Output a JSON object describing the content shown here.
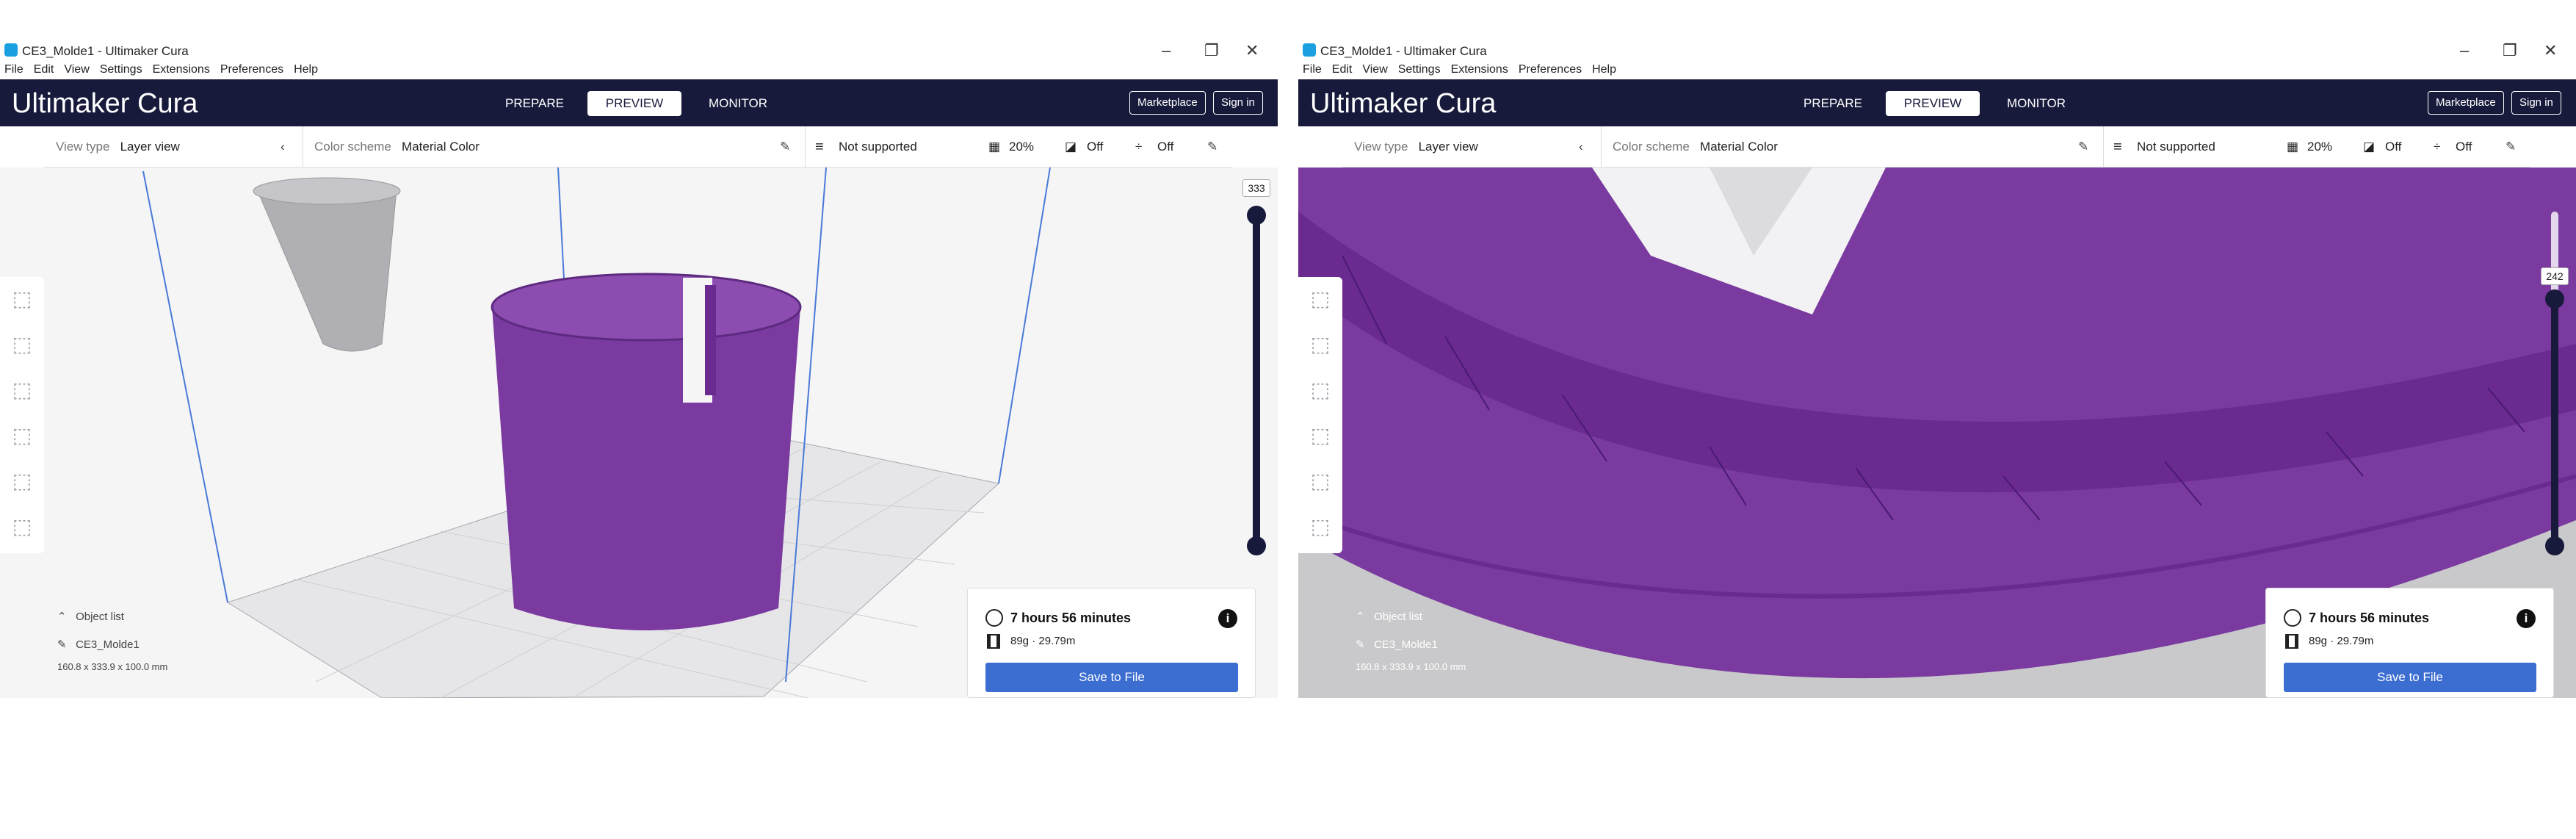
{
  "window": {
    "title": "CE3_Molde1 - Ultimaker Cura",
    "minimize": "–",
    "restore": "❐",
    "close": "✕"
  },
  "menu": [
    "File",
    "Edit",
    "View",
    "Settings",
    "Extensions",
    "Preferences",
    "Help"
  ],
  "header": {
    "logo_bold": "Ultimaker",
    "logo_light": "Cura",
    "tabs": [
      "PREPARE",
      "PREVIEW",
      "MONITOR"
    ],
    "active_tab": "PREVIEW",
    "marketplace": "Marketplace",
    "signin": "Sign in"
  },
  "toolbar": {
    "view_type_label": "View type",
    "view_type_value": "Layer view",
    "color_scheme_label": "Color scheme",
    "color_scheme_value": "Material Color",
    "support": "Not supported",
    "infill": "20%",
    "adhesion": "Off",
    "support_toggle": "Off"
  },
  "object": {
    "list_label": "Object list",
    "name": "CE3_Molde1",
    "dimensions": "160.8 x 333.9 x 100.0 mm"
  },
  "print": {
    "time": "7 hours 56 minutes",
    "material": "89g · 29.79m",
    "save": "Save to File"
  },
  "left": {
    "layer_value": "333"
  },
  "right": {
    "layer_value": "242"
  },
  "colors": {
    "header": "#181a3c",
    "purple": "#7a3aa0",
    "save_blue": "#3c6dd0"
  }
}
